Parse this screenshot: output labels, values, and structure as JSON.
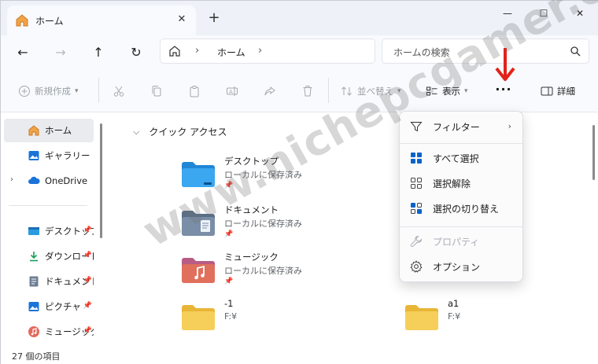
{
  "tab": {
    "title": "ホーム",
    "close": "✕"
  },
  "newtab": "+",
  "window_controls": {
    "minimize": "—",
    "maximize": "☐",
    "close": "✕"
  },
  "nav": {
    "back": "←",
    "forward": "→",
    "up": "↑",
    "refresh": "↻"
  },
  "address": {
    "separator": "›",
    "location": "ホーム"
  },
  "search": {
    "placeholder": "ホームの検索"
  },
  "toolbar": {
    "new": "新規作成",
    "sort": "並べ替え",
    "view": "表示",
    "more": "···",
    "details": "詳細"
  },
  "sidebar": {
    "home": "ホーム",
    "gallery": "ギャラリー",
    "onedrive": "OneDrive",
    "expand": "›",
    "pinned": [
      {
        "label": "デスクトップ"
      },
      {
        "label": "ダウンロード"
      },
      {
        "label": "ドキュメント"
      },
      {
        "label": "ピクチャ"
      },
      {
        "label": "ミュージック"
      }
    ]
  },
  "main": {
    "section": "クイック アクセス",
    "items": [
      {
        "name": "デスクトップ",
        "sub": "ローカルに保存済み"
      },
      {
        "name": "ドキュメント",
        "sub": "ローカルに保存済み"
      },
      {
        "name": "ミュージック",
        "sub": "ローカルに保存済み"
      },
      {
        "name": "-1",
        "sub": "F:¥"
      },
      {
        "name": "a1",
        "sub": "F:¥"
      }
    ]
  },
  "menu": {
    "filter": "フィルター",
    "select_all": "すべて選択",
    "select_none": "選択解除",
    "invert": "選択の切り替え",
    "properties": "プロパティ",
    "options": "オプション"
  },
  "status": {
    "count": "27 個の項目"
  },
  "watermark": "www.nichepcgamer.com",
  "colors": {
    "folder": "#f3c64b",
    "accent": "#0a63c9",
    "annotation": "#e2231a"
  }
}
